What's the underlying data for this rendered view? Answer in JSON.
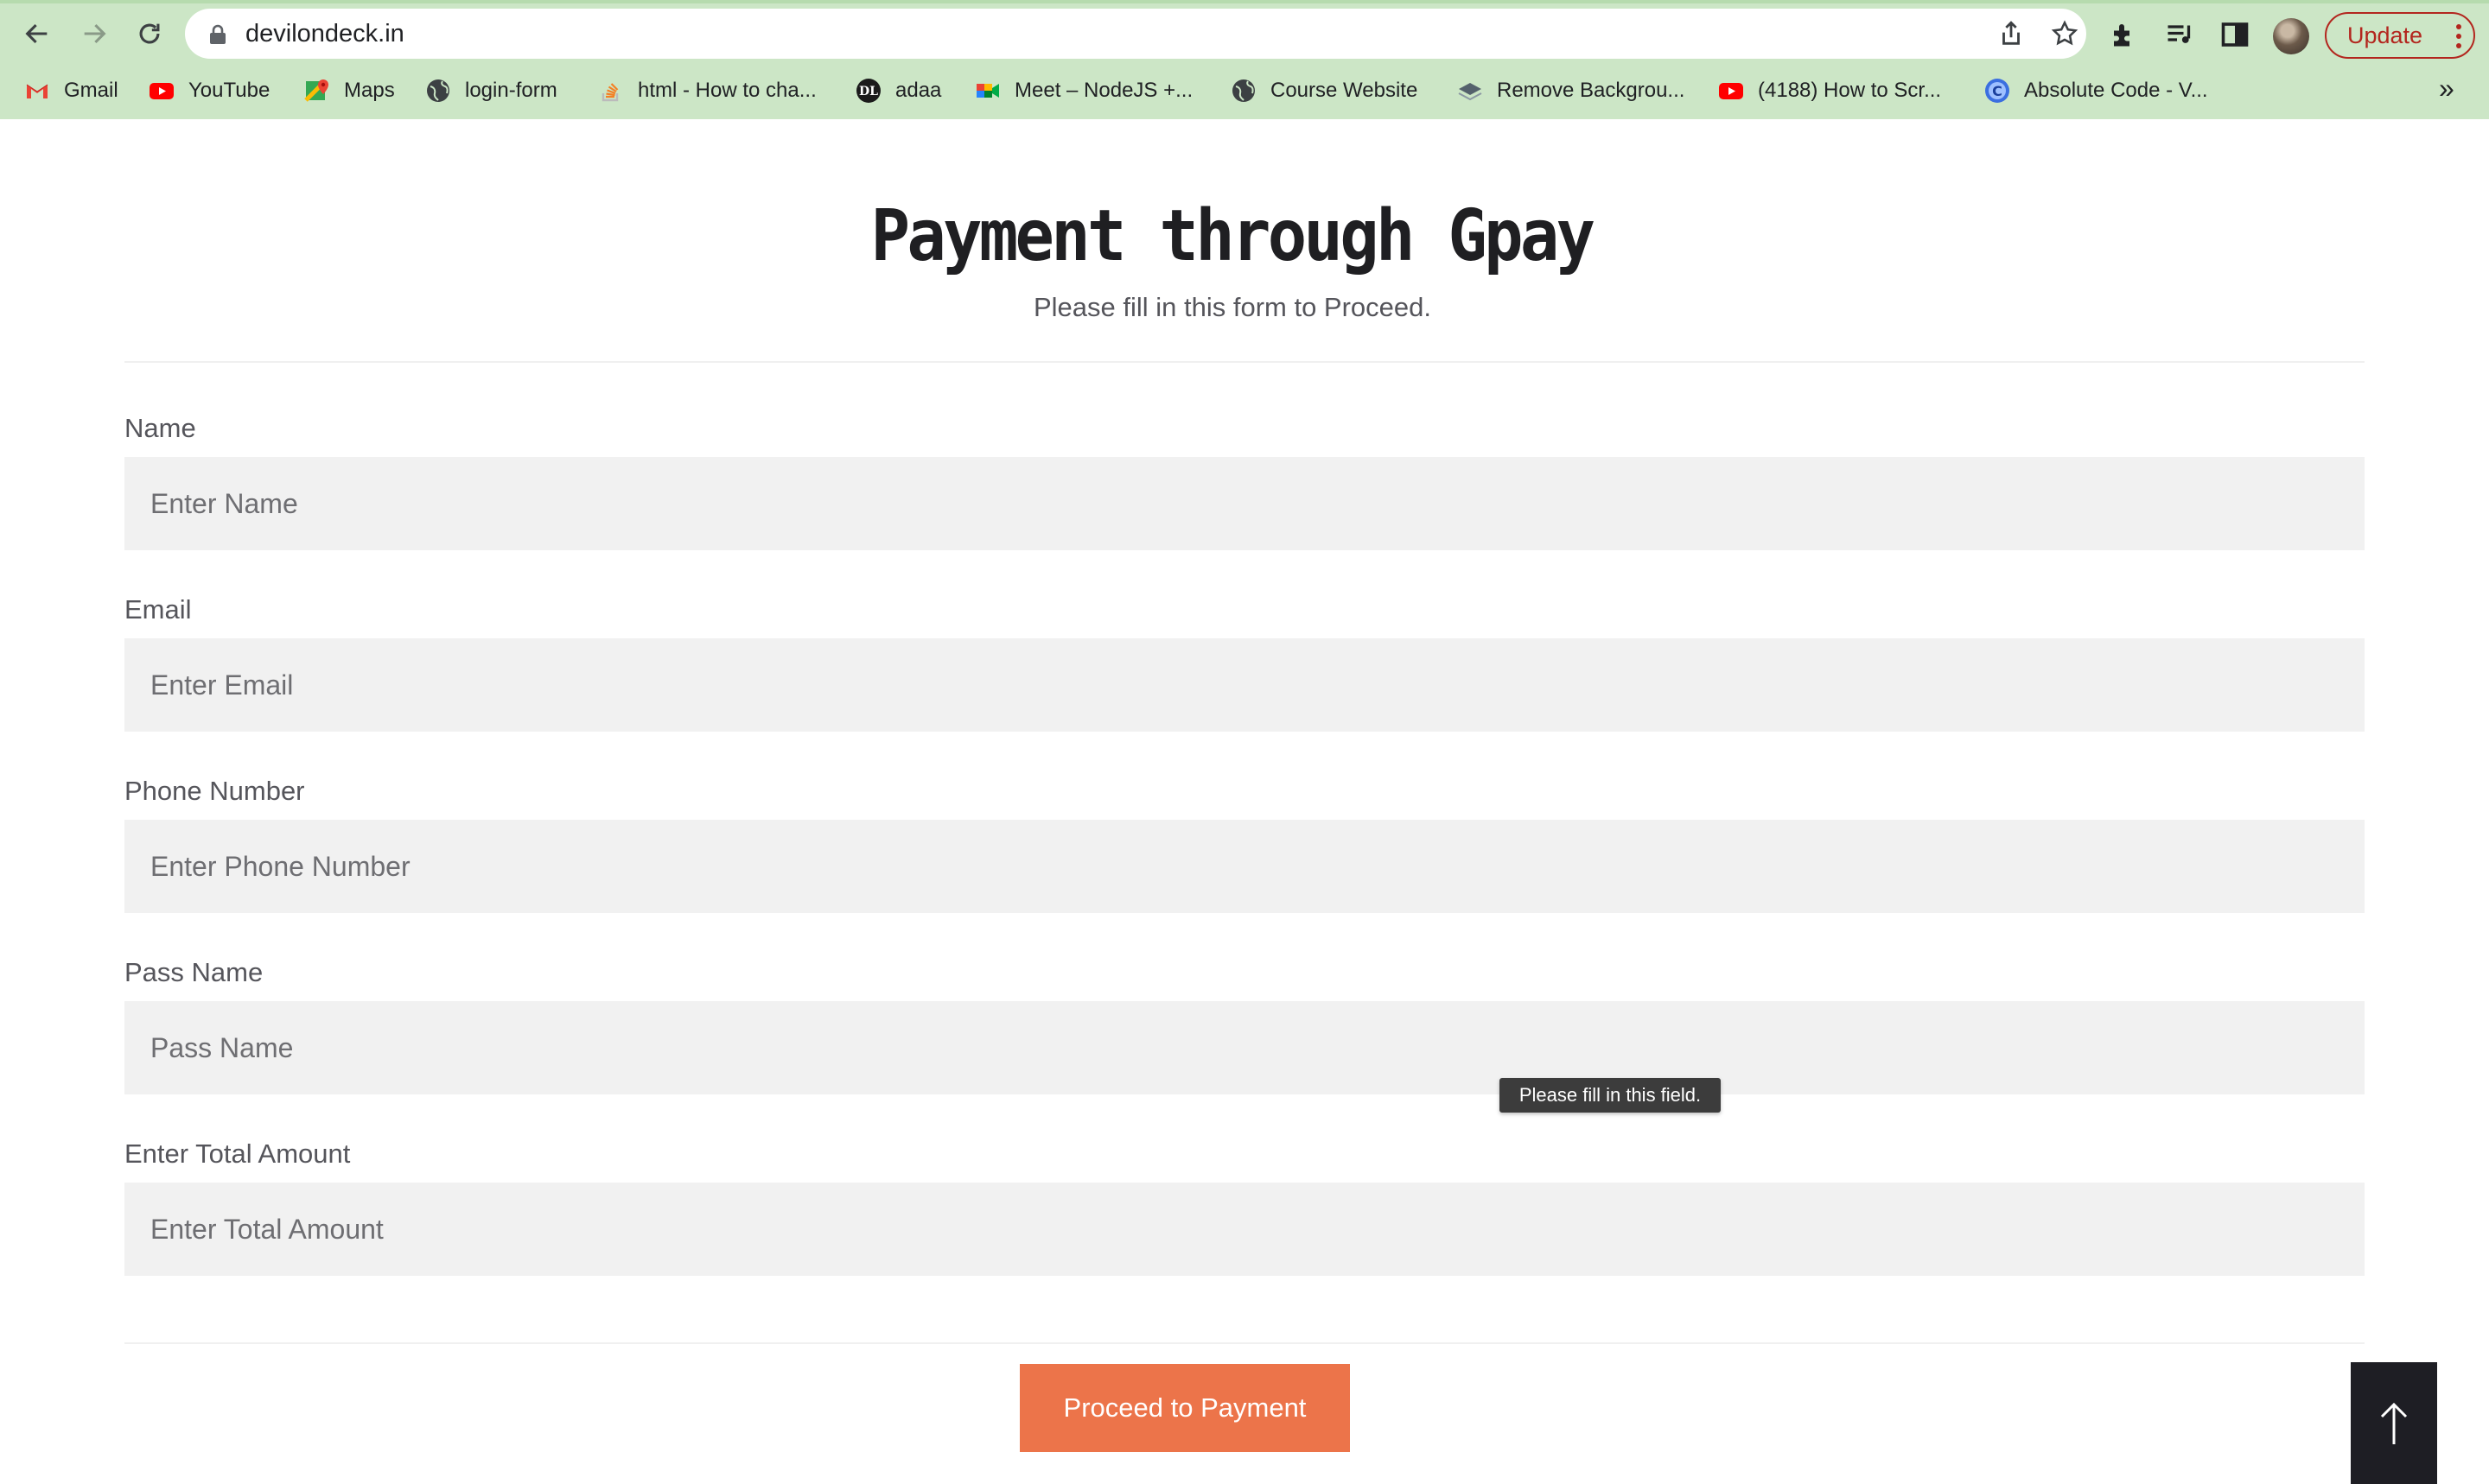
{
  "browser": {
    "url": "devilondeck.in",
    "update_label": "Update",
    "bookmarks": [
      {
        "label": "Gmail",
        "icon": "gmail-icon"
      },
      {
        "label": "YouTube",
        "icon": "youtube-icon"
      },
      {
        "label": "Maps",
        "icon": "maps-icon"
      },
      {
        "label": "login-form",
        "icon": "globe-icon"
      },
      {
        "label": "html - How to cha...",
        "icon": "stackoverflow-icon"
      },
      {
        "label": "adaa",
        "icon": "dl-logo-icon"
      },
      {
        "label": "Meet – NodeJS +...",
        "icon": "meet-icon"
      },
      {
        "label": "Course Website",
        "icon": "globe-icon"
      },
      {
        "label": "Remove Backgrou...",
        "icon": "remove-bg-icon"
      },
      {
        "label": "(4188) How to Scr...",
        "icon": "youtube-icon"
      },
      {
        "label": "Absolute Code - V...",
        "icon": "absolute-code-icon"
      }
    ],
    "more_label": "»"
  },
  "page": {
    "title": "Payment through Gpay",
    "subtitle": "Please fill in this form to Proceed."
  },
  "form": {
    "fields": [
      {
        "label": "Name",
        "placeholder": "Enter Name",
        "value": ""
      },
      {
        "label": "Email",
        "placeholder": "Enter Email",
        "value": ""
      },
      {
        "label": "Phone Number",
        "placeholder": "Enter Phone Number",
        "value": ""
      },
      {
        "label": "Pass Name",
        "placeholder": "Pass Name",
        "value": ""
      },
      {
        "label": "Enter Total Amount",
        "placeholder": "Enter Total Amount",
        "value": ""
      }
    ],
    "validation_tooltip": "Please fill in this field.",
    "submit_label": "Proceed to Payment"
  },
  "colors": {
    "chrome_bg": "#cce6c6",
    "input_bg": "#f1f1f1",
    "button": "#ec744a",
    "scroll_top_bg": "#1e1e24",
    "update_accent": "#b3261e"
  }
}
